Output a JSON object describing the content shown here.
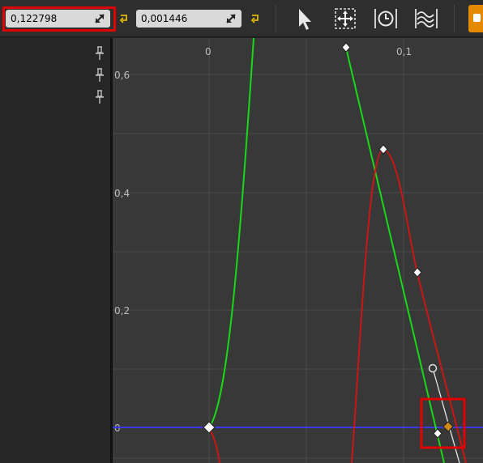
{
  "toolbar": {
    "time_value": "0,122798",
    "value_value": "0,001446",
    "buttons": [
      "select-tool",
      "frame-tool",
      "time-tool",
      "normalize-tool"
    ]
  },
  "graph": {
    "x_ticks": [
      "0",
      "0,1"
    ],
    "y_ticks": [
      "0,6",
      "0,4",
      "0,2",
      "0"
    ]
  },
  "colors": {
    "green_curve": "#18d818",
    "red_curve": "#cc1515",
    "blue_line": "#3a3ae0",
    "highlight": "#e20000",
    "selected_key": "#d08a14"
  }
}
